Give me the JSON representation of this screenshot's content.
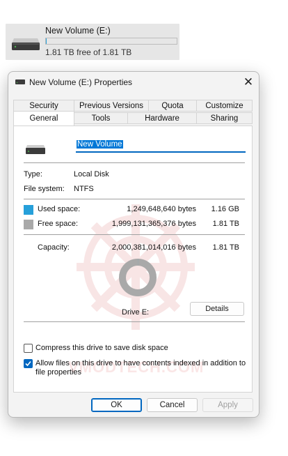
{
  "drive_tile": {
    "name": "New Volume (E:)",
    "free_text": "1.81 TB free of 1.81 TB",
    "used_fraction": 0.0006
  },
  "dialog": {
    "title": "New Volume (E:) Properties",
    "close_icon": "close-icon",
    "tabs_top": [
      "Security",
      "Previous Versions",
      "Quota",
      "Customize"
    ],
    "tabs_bottom": [
      "General",
      "Tools",
      "Hardware",
      "Sharing"
    ],
    "selected_tab": "General"
  },
  "general": {
    "volume_name": "New Volume",
    "type_label": "Type:",
    "type_value": "Local Disk",
    "fs_label": "File system:",
    "fs_value": "NTFS",
    "used": {
      "label": "Used space:",
      "bytes": "1,249,648,640 bytes",
      "size": "1.16 GB",
      "color": "#26a0da"
    },
    "free": {
      "label": "Free space:",
      "bytes": "1,999,131,365,376 bytes",
      "size": "1.81 TB",
      "color": "#a9a9a9"
    },
    "capacity": {
      "label": "Capacity:",
      "bytes": "2,000,381,014,016 bytes",
      "size": "1.81 TB"
    },
    "drive_label": "Drive E:",
    "details_label": "Details",
    "compress": {
      "label": "Compress this drive to save disk space",
      "checked": false
    },
    "index": {
      "label": "Allow files on this drive to have contents indexed in addition to",
      "label2": "file properties",
      "checked": true
    }
  },
  "buttons": {
    "ok": "OK",
    "cancel": "Cancel",
    "apply": "Apply"
  },
  "watermark_text": "VMODTECH.COM"
}
